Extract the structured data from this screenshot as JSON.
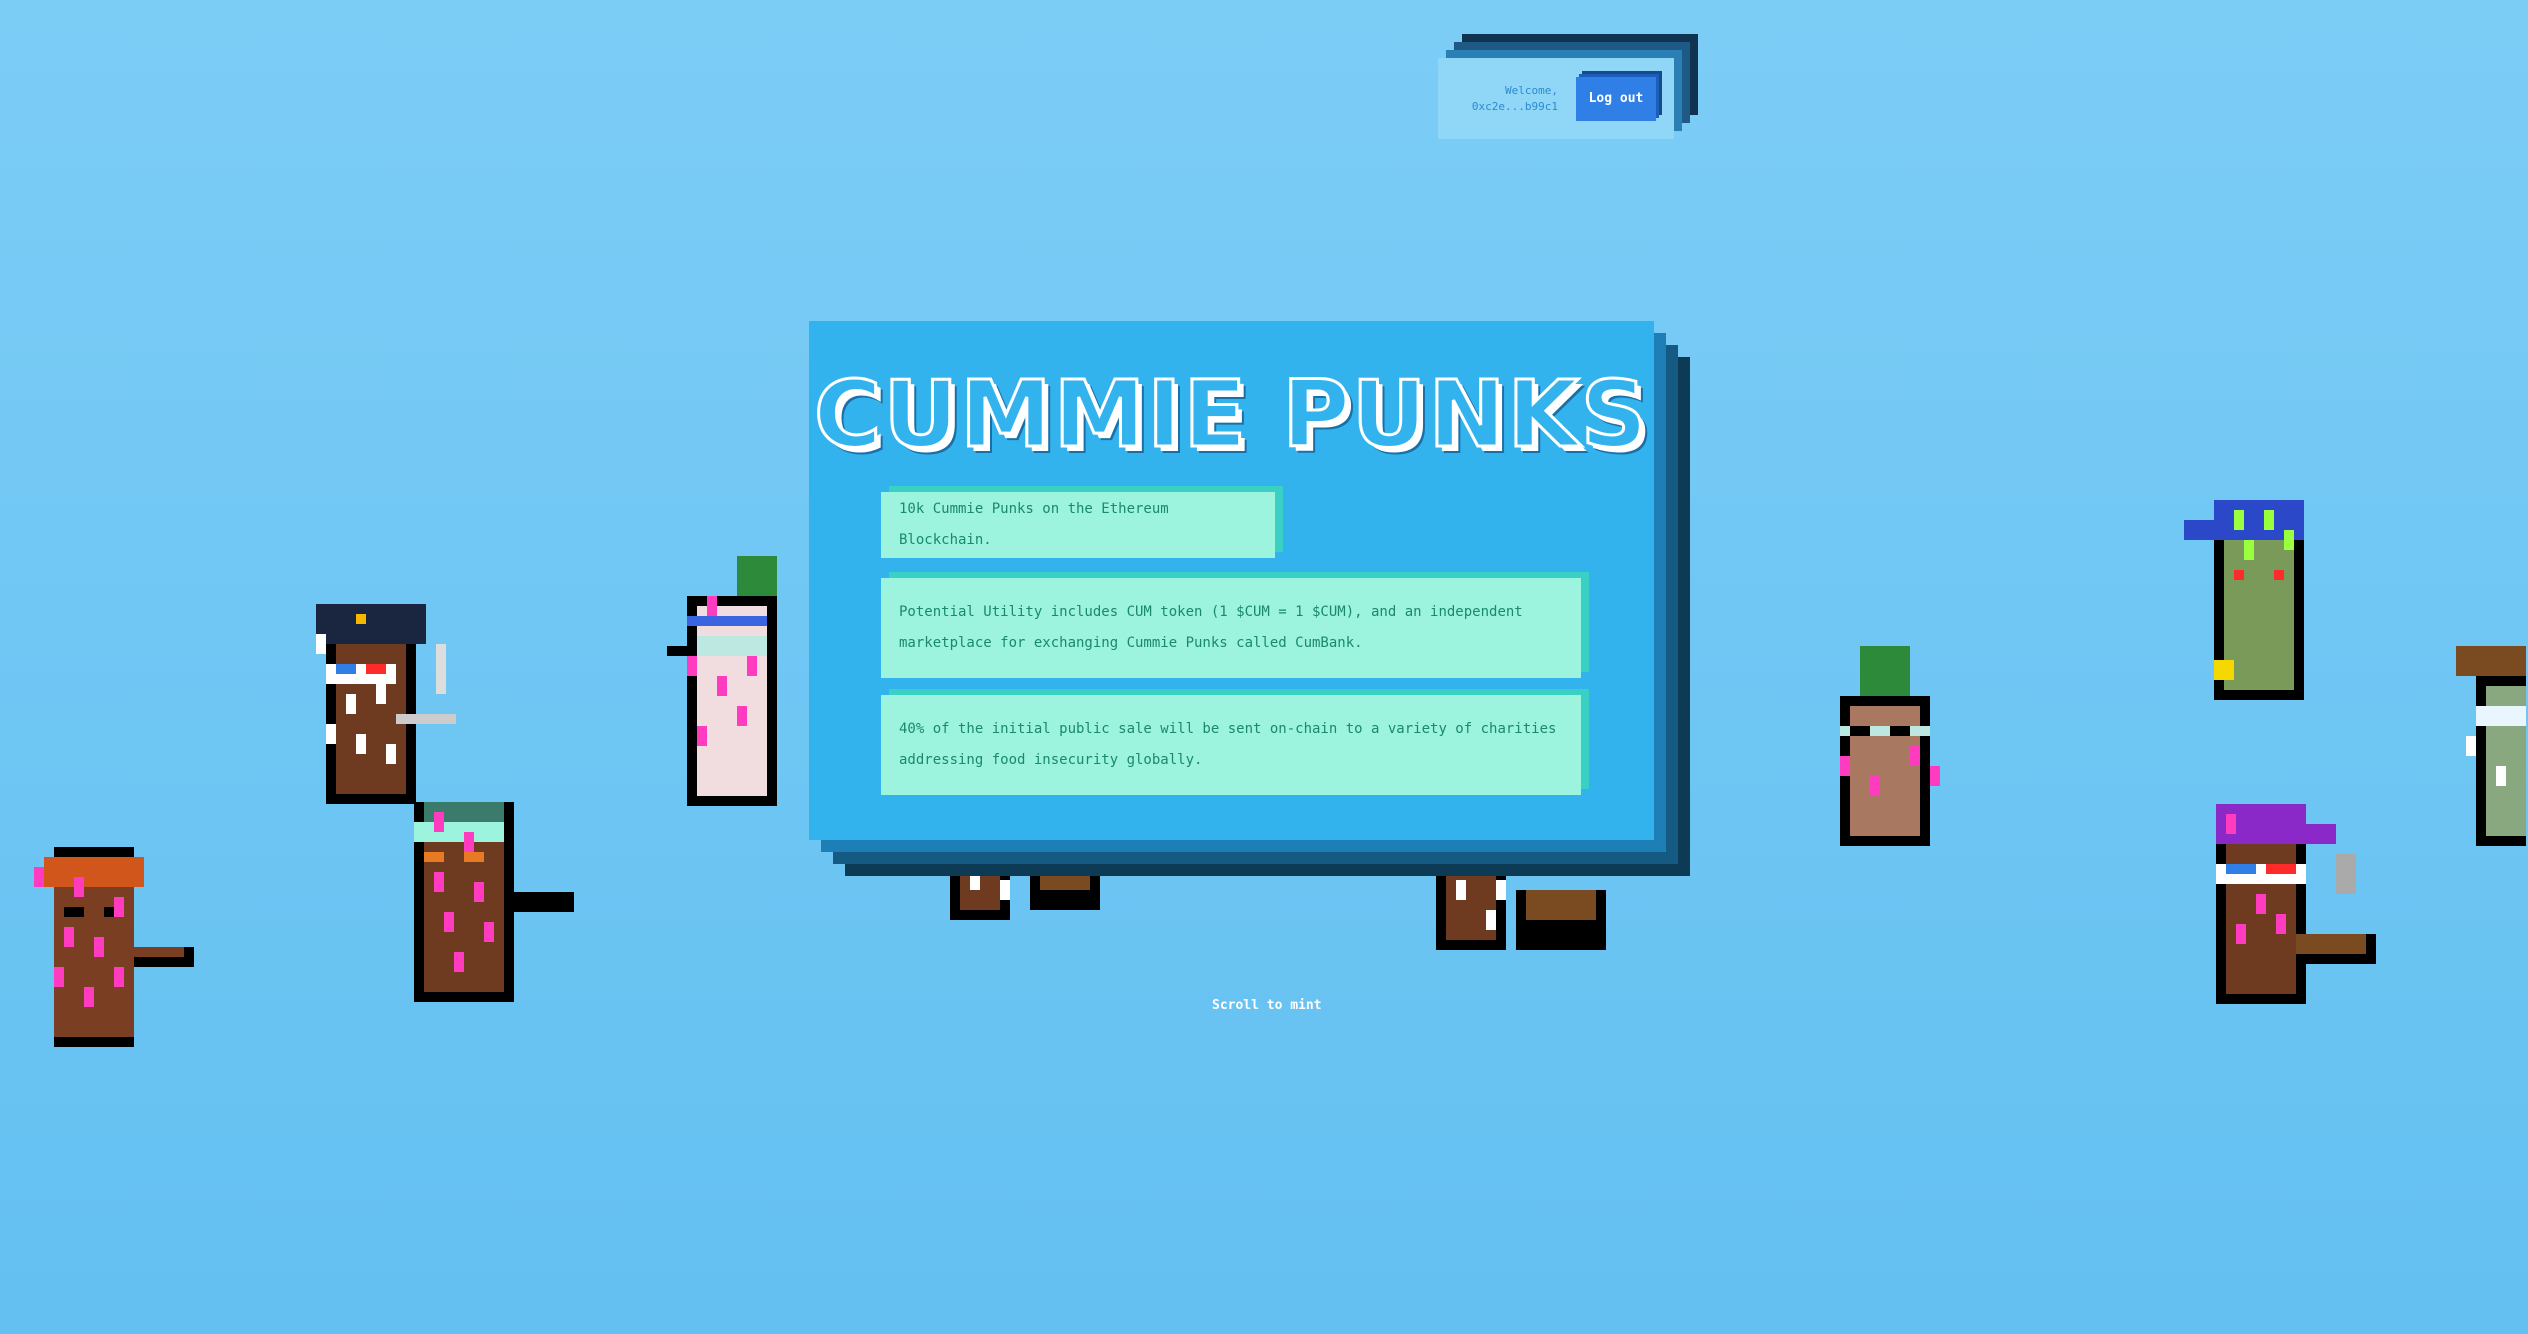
{
  "wallet": {
    "welcome": "Welcome,",
    "address": "0xc2e...b99c1",
    "logout_label": "Log out"
  },
  "hero": {
    "title": "CUMMIE PUNKS",
    "info": [
      "10k Cummie Punks on the Ethereum Blockchain.",
      "Potential Utility includes CUM token (1 $CUM = 1 $CUM), and an independent marketplace for exchanging Cummie Punks called CumBank.",
      "40% of the initial public sale will be sent on-chain to a variety of charities addressing food insecurity globally."
    ]
  },
  "scroll_hint": "Scroll to mint",
  "colors": {
    "background": "#74c8f4",
    "card": "#33b3ee",
    "info_box": "#9cf3de",
    "button": "#2f7fe6"
  }
}
